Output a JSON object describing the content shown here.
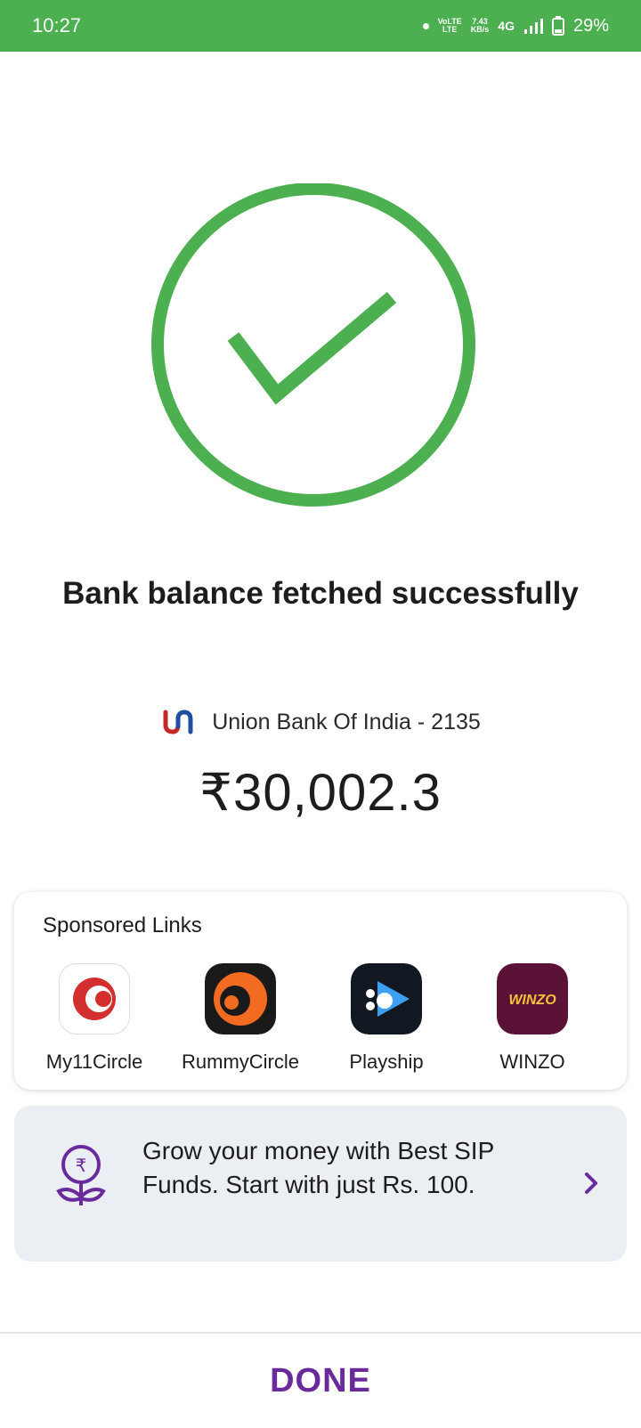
{
  "status_bar": {
    "time": "10:27",
    "volte_label_top": "VoLTE",
    "volte_label_bottom": "LTE",
    "speed_value": "7.43",
    "speed_unit": "KB/s",
    "network": "4G",
    "battery": "29%",
    "icons": [
      "notification-dot-icon",
      "volte-icon",
      "signal-icon",
      "battery-icon"
    ]
  },
  "result": {
    "icon": "check-circle-icon",
    "headline": "Bank balance fetched successfully",
    "bank_name": "Union Bank Of India - 2135",
    "balance": "₹30,002.3"
  },
  "sponsored": {
    "title": "Sponsored Links",
    "apps": [
      {
        "label": "My11Circle",
        "icon": "my11circle-icon"
      },
      {
        "label": "RummyCircle",
        "icon": "rummycircle-icon"
      },
      {
        "label": "Playship",
        "icon": "playship-icon"
      },
      {
        "label": "WINZO",
        "icon": "winzo-icon",
        "icon_text": "WINZO"
      }
    ]
  },
  "sip_banner": {
    "text": "Grow your money with Best SIP Funds. Start with just Rs. 100.",
    "icon": "money-plant-icon",
    "icon_symbol": "₹"
  },
  "footer": {
    "done_label": "DONE"
  },
  "colors": {
    "status_bar": "#4caf50",
    "success_green": "#4caf50",
    "accent_purple": "#6a2a9c",
    "sip_card_bg": "#ebeef2"
  }
}
